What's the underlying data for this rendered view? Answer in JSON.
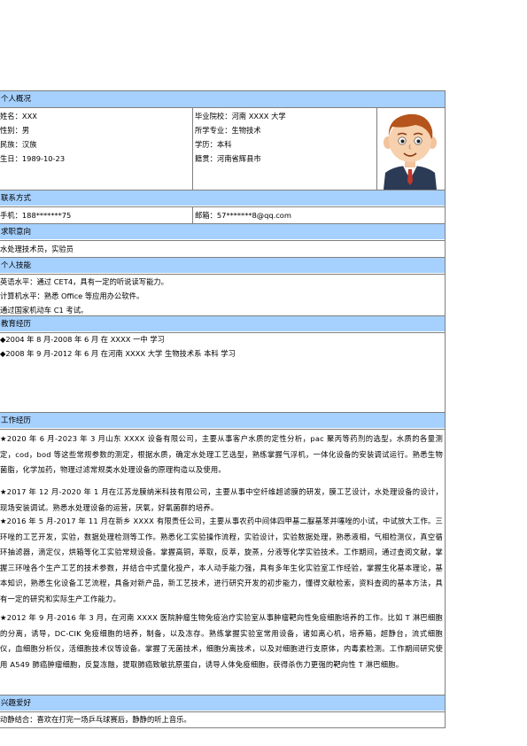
{
  "sections": {
    "personal": "个人概况",
    "contact": "联系方式",
    "intent": "求职意向",
    "skills": "个人技能",
    "education": "教育经历",
    "work": "工作经历",
    "hobby": "兴趣爱好"
  },
  "personal": {
    "name": "姓名：XXX",
    "gender": "性别：男",
    "ethnicity": "民族：汉族",
    "birthday": "生日：1989-10-23",
    "school": "毕业院校：河南 XXXX 大学",
    "major": "所学专业：生物技术",
    "degree": "学历：本科",
    "origin": "籍贯：河南省辉县市"
  },
  "contact": {
    "phone": "手机：188*******75",
    "email": "邮箱：57*******8@qq.com"
  },
  "intent": "水处理技术员，实验员",
  "skills": [
    "英语水平：通过 CET4，具有一定的听说读写能力。",
    "计算机水平：熟悉 Office 等应用办公软件。",
    "通过国家机动车 C1 考试。"
  ],
  "education": [
    "◆2004 年 8 月-2008 年 6 月 在 XXXX 一中 学习",
    "◆2008 年 9 月-2012 年 6 月 在河南 XXXX 大学 生物技术系 本科 学习"
  ],
  "work": [
    "★2020 年 6 月-2023 年 3 月山东 XXXX 设备有限公司，主要从事客户水质的定性分析，pac 聚丙等药剂的选型，水质的各量测定，cod，bod 等这些常规参数的测定，根据水质，确定水处理工艺选型，熟练掌握气浮机，一体化设备的安装调试运行。熟悉生物菌脂，化学加药，物理过滤常规类水处理设备的原理构造以及使用。",
    "★2017 年 12 月-2020 年 1 月在江苏龙膜纳米科技有限公司，主要从事中空纤维超滤膜的研发，膜工艺设计，水处理设备的设计，现场安装调试。熟悉水处理设备的运营，厌氧，好氧菌群的培养。",
    "★2016 年 5 月-2017 年 11 月在新乡 XXXX 有限责任公司，主要从事农药中间体四甲基二脲基苯并噻唑的小试，中试放大工作。三环唑的工艺开发，实验，数据处理检测等工作。熟悉化工实验操作流程，实验设计，实验数据处理，熟悉液相，气相检测仪，真空循环抽滤器，滴定仪，烘箱等化工实验常规设备。掌握高铜，萃取，反萃，旋蒸，分液等化学实验技术。工作期间，通过查阅文献，掌握三环唑各个生产工艺的技术参数，并结合中式量化投产，本人动手能力强，具有多年生化实验室工作经验，掌握生化基本理论，基本知识，熟悉生化设备工艺流程，具备对新产品，新工艺技术，进行研究开发的初步能力，懂得文献检索，资料查阅的基本方法，具有一定的研究和实际生产工作能力。",
    "★2012 年 9 月-2016 年 3 月，在河南 XXXX 医院肿瘤生物免疫治疗实验室从事肿瘤靶向性免疫细胞培养的工作。比如 T 淋巴细胞的分离，诱导，DC-CIK 免疫细胞的培养，制备，以及冻存。熟练掌握实验室常用设备，诸如离心机，培养箱，超静台，流式细胞仪，血细胞分析仪，活细胞技术仪等设备。掌握了无菌技术，细胞分离技术，以及对细胞进行支原体，内毒素检测。工作期间研究使用 A549 肺癌肿瘤细胞，反复冻融，提取肺癌致敏抗原蛋白，诱导人体免疫细胞，获得杀伤力更强的靶向性 T 淋巴细胞。"
  ],
  "hobby": "动静结合：喜欢在打完一场乒乓球赛后，静静的听上音乐。",
  "colors": {
    "section_bg": "#a6d1ff",
    "border": "#7f7f7f"
  }
}
